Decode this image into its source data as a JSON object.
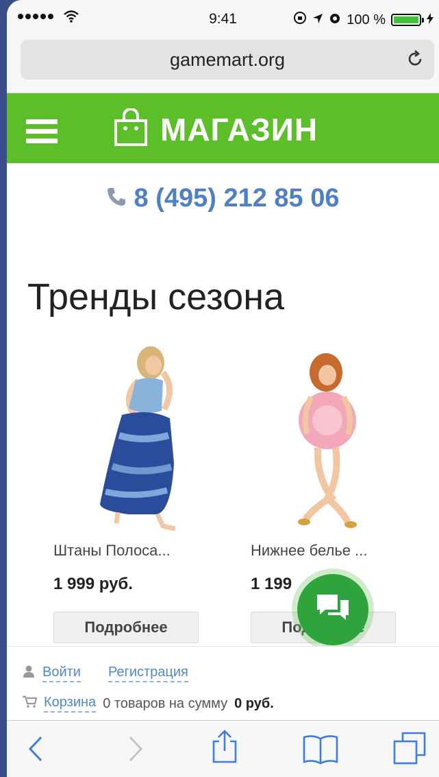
{
  "status_bar": {
    "time": "9:41",
    "battery_percent": "100 %",
    "battery_level": 1.0,
    "icons": [
      "signal-dots-icon",
      "wifi-icon",
      "rotation-lock-icon",
      "location-arrow-icon",
      "alarm-icon",
      "battery-icon",
      "charging-bolt-icon"
    ]
  },
  "browser": {
    "url": "gamemart.org",
    "reload_icon": "reload-icon"
  },
  "header": {
    "menu_icon": "hamburger-menu-icon",
    "logo_icon": "shopping-bag-icon",
    "title": "МАГАЗИН",
    "color": "#5cbf2a"
  },
  "contact": {
    "phone_icon": "phone-icon",
    "phone": "8 (495) 212 85 06"
  },
  "section": {
    "title": "Тренды сезона"
  },
  "products": [
    {
      "name": "Штаны Полоса...",
      "price": "1 999 руб.",
      "button": "Подробнее"
    },
    {
      "name": "Нижнее белье ...",
      "price": "1 199",
      "button": "Подробнее"
    }
  ],
  "chat": {
    "icon": "chat-bubbles-icon",
    "color": "#2fa43c"
  },
  "footer": {
    "login": "Войти",
    "register": "Регистрация",
    "cart": "Корзина",
    "cart_summary": "0 товаров на сумму",
    "cart_total": "0 руб."
  },
  "toolbar": {
    "icons": [
      "back-icon",
      "forward-icon",
      "share-icon",
      "bookmarks-icon",
      "tabs-icon"
    ]
  }
}
